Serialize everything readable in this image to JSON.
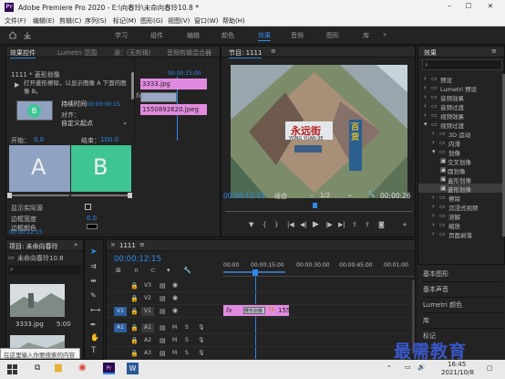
{
  "app": {
    "logo": "Pr",
    "title": "Adobe Premiere Pro 2020 - E:\\向春玲\\未命向春玲10.8 *"
  },
  "menus": [
    "文件(F)",
    "编辑(E)",
    "剪辑(C)",
    "序列(S)",
    "标记(M)",
    "图形(G)",
    "视图(V)",
    "窗口(W)",
    "帮助(H)"
  ],
  "workspaces": {
    "items": [
      "学习",
      "组件",
      "编辑",
      "颜色",
      "效果",
      "音频",
      "图形",
      "库"
    ],
    "active": "效果",
    "menu_icon": "double-chevron-icon"
  },
  "effect_controls": {
    "tabs": [
      "效果控件",
      "Lumetri 范围",
      "源：(无剪辑)",
      "音频剪辑混合器"
    ],
    "clip_title": "1111 * 菱形划像",
    "play_label": "▶",
    "description": "打开菱形擦除，以显示图像 A 下面的图像 B。",
    "mini_ruler": "00:00:15:00",
    "duration_label": "持续时间",
    "duration_value": "00:00:00:15",
    "alignment_label": "对齐：",
    "alignment_value": "自定义起点",
    "start_label": "开始：",
    "start_value": "0.0",
    "end_label": "结束：",
    "end_value": "100.0",
    "track_a_label": "A",
    "track_b_label": "B",
    "clip_a": "3333.jpg",
    "clip_b": "1550892620.jpeg",
    "fx_label": "fx",
    "show_actual_label": "显示实际源",
    "border_width_label": "边框宽度",
    "border_width_value": "0.0",
    "border_color_label": "边框颜色",
    "timecode": "00:00:12:15",
    "colors": {
      "a_box": "#8fa2c2",
      "b_box": "#3fc594",
      "pink_clip": "#e18be0",
      "blue_accent": "#2d8ceb"
    }
  },
  "program_monitor": {
    "title": "节目: 1111",
    "menu_icon": "hamburger-icon",
    "timecode": "00:00:12:15",
    "fit_label": "适合",
    "ratio_label": "1/2",
    "end_timecode": "00:00:26",
    "sign_main": "永远街",
    "sign_sub": "YONG YUAN JIE",
    "sign_side": "百货"
  },
  "project_panel": {
    "title": "项目: 未命向春玲",
    "path_label": "未命向春玲10.8",
    "thumbnails": [
      {
        "name": "3333.jpg",
        "duration": "5:00"
      },
      {
        "name": "",
        "duration": ""
      }
    ]
  },
  "timeline": {
    "title": "1111",
    "timecode": "00:00:12:15",
    "ruler": [
      "00:00",
      "00:00:15:00",
      "00:00:30:00",
      "00:00:45:00",
      "00:01:00"
    ],
    "video_tracks": [
      "V3",
      "V2",
      "V1"
    ],
    "audio_tracks": [
      "A1",
      "A2",
      "A3"
    ],
    "source_v": "V1",
    "source_a": "A1",
    "clips": [
      {
        "track": "V1",
        "label": "菱形划像",
        "fx": "fx",
        "number": "155"
      }
    ],
    "m_label": "M",
    "s_label": "S"
  },
  "effects_panel": {
    "title": "效果",
    "menu_icon": "hamburger-icon",
    "tree": [
      {
        "label": "预设",
        "indent": 0,
        "expanded": false
      },
      {
        "label": "Lumetri 预设",
        "indent": 0,
        "expanded": false
      },
      {
        "label": "音频效果",
        "indent": 0,
        "expanded": false
      },
      {
        "label": "音频过渡",
        "indent": 0,
        "expanded": false
      },
      {
        "label": "视频效果",
        "indent": 0,
        "expanded": false
      },
      {
        "label": "视频过渡",
        "indent": 0,
        "expanded": true
      },
      {
        "label": "3D 运动",
        "indent": 1,
        "expanded": false
      },
      {
        "label": "内滑",
        "indent": 1,
        "expanded": false
      },
      {
        "label": "划像",
        "indent": 1,
        "expanded": true
      },
      {
        "label": "交叉划像",
        "indent": 2,
        "expanded": false
      },
      {
        "label": "圆划像",
        "indent": 2,
        "expanded": false
      },
      {
        "label": "盒形划像",
        "indent": 2,
        "expanded": false
      },
      {
        "label": "菱形划像",
        "indent": 2,
        "expanded": false,
        "selected": true
      },
      {
        "label": "擦除",
        "indent": 1,
        "expanded": false
      },
      {
        "label": "沉浸式视频",
        "indent": 1,
        "expanded": false
      },
      {
        "label": "溶解",
        "indent": 1,
        "expanded": false
      },
      {
        "label": "缩放",
        "indent": 1,
        "expanded": false
      },
      {
        "label": "页面剥落",
        "indent": 1,
        "expanded": false
      }
    ],
    "bottom_items": [
      "基本图形",
      "基本声音",
      "Lumetri 颜色",
      "库",
      "标记"
    ]
  },
  "search": {
    "placeholder": "在这里输入你要搜索的内容"
  },
  "watermark": "最需教育",
  "taskbar": {
    "time": "16:45",
    "date": "2021/10/8"
  }
}
